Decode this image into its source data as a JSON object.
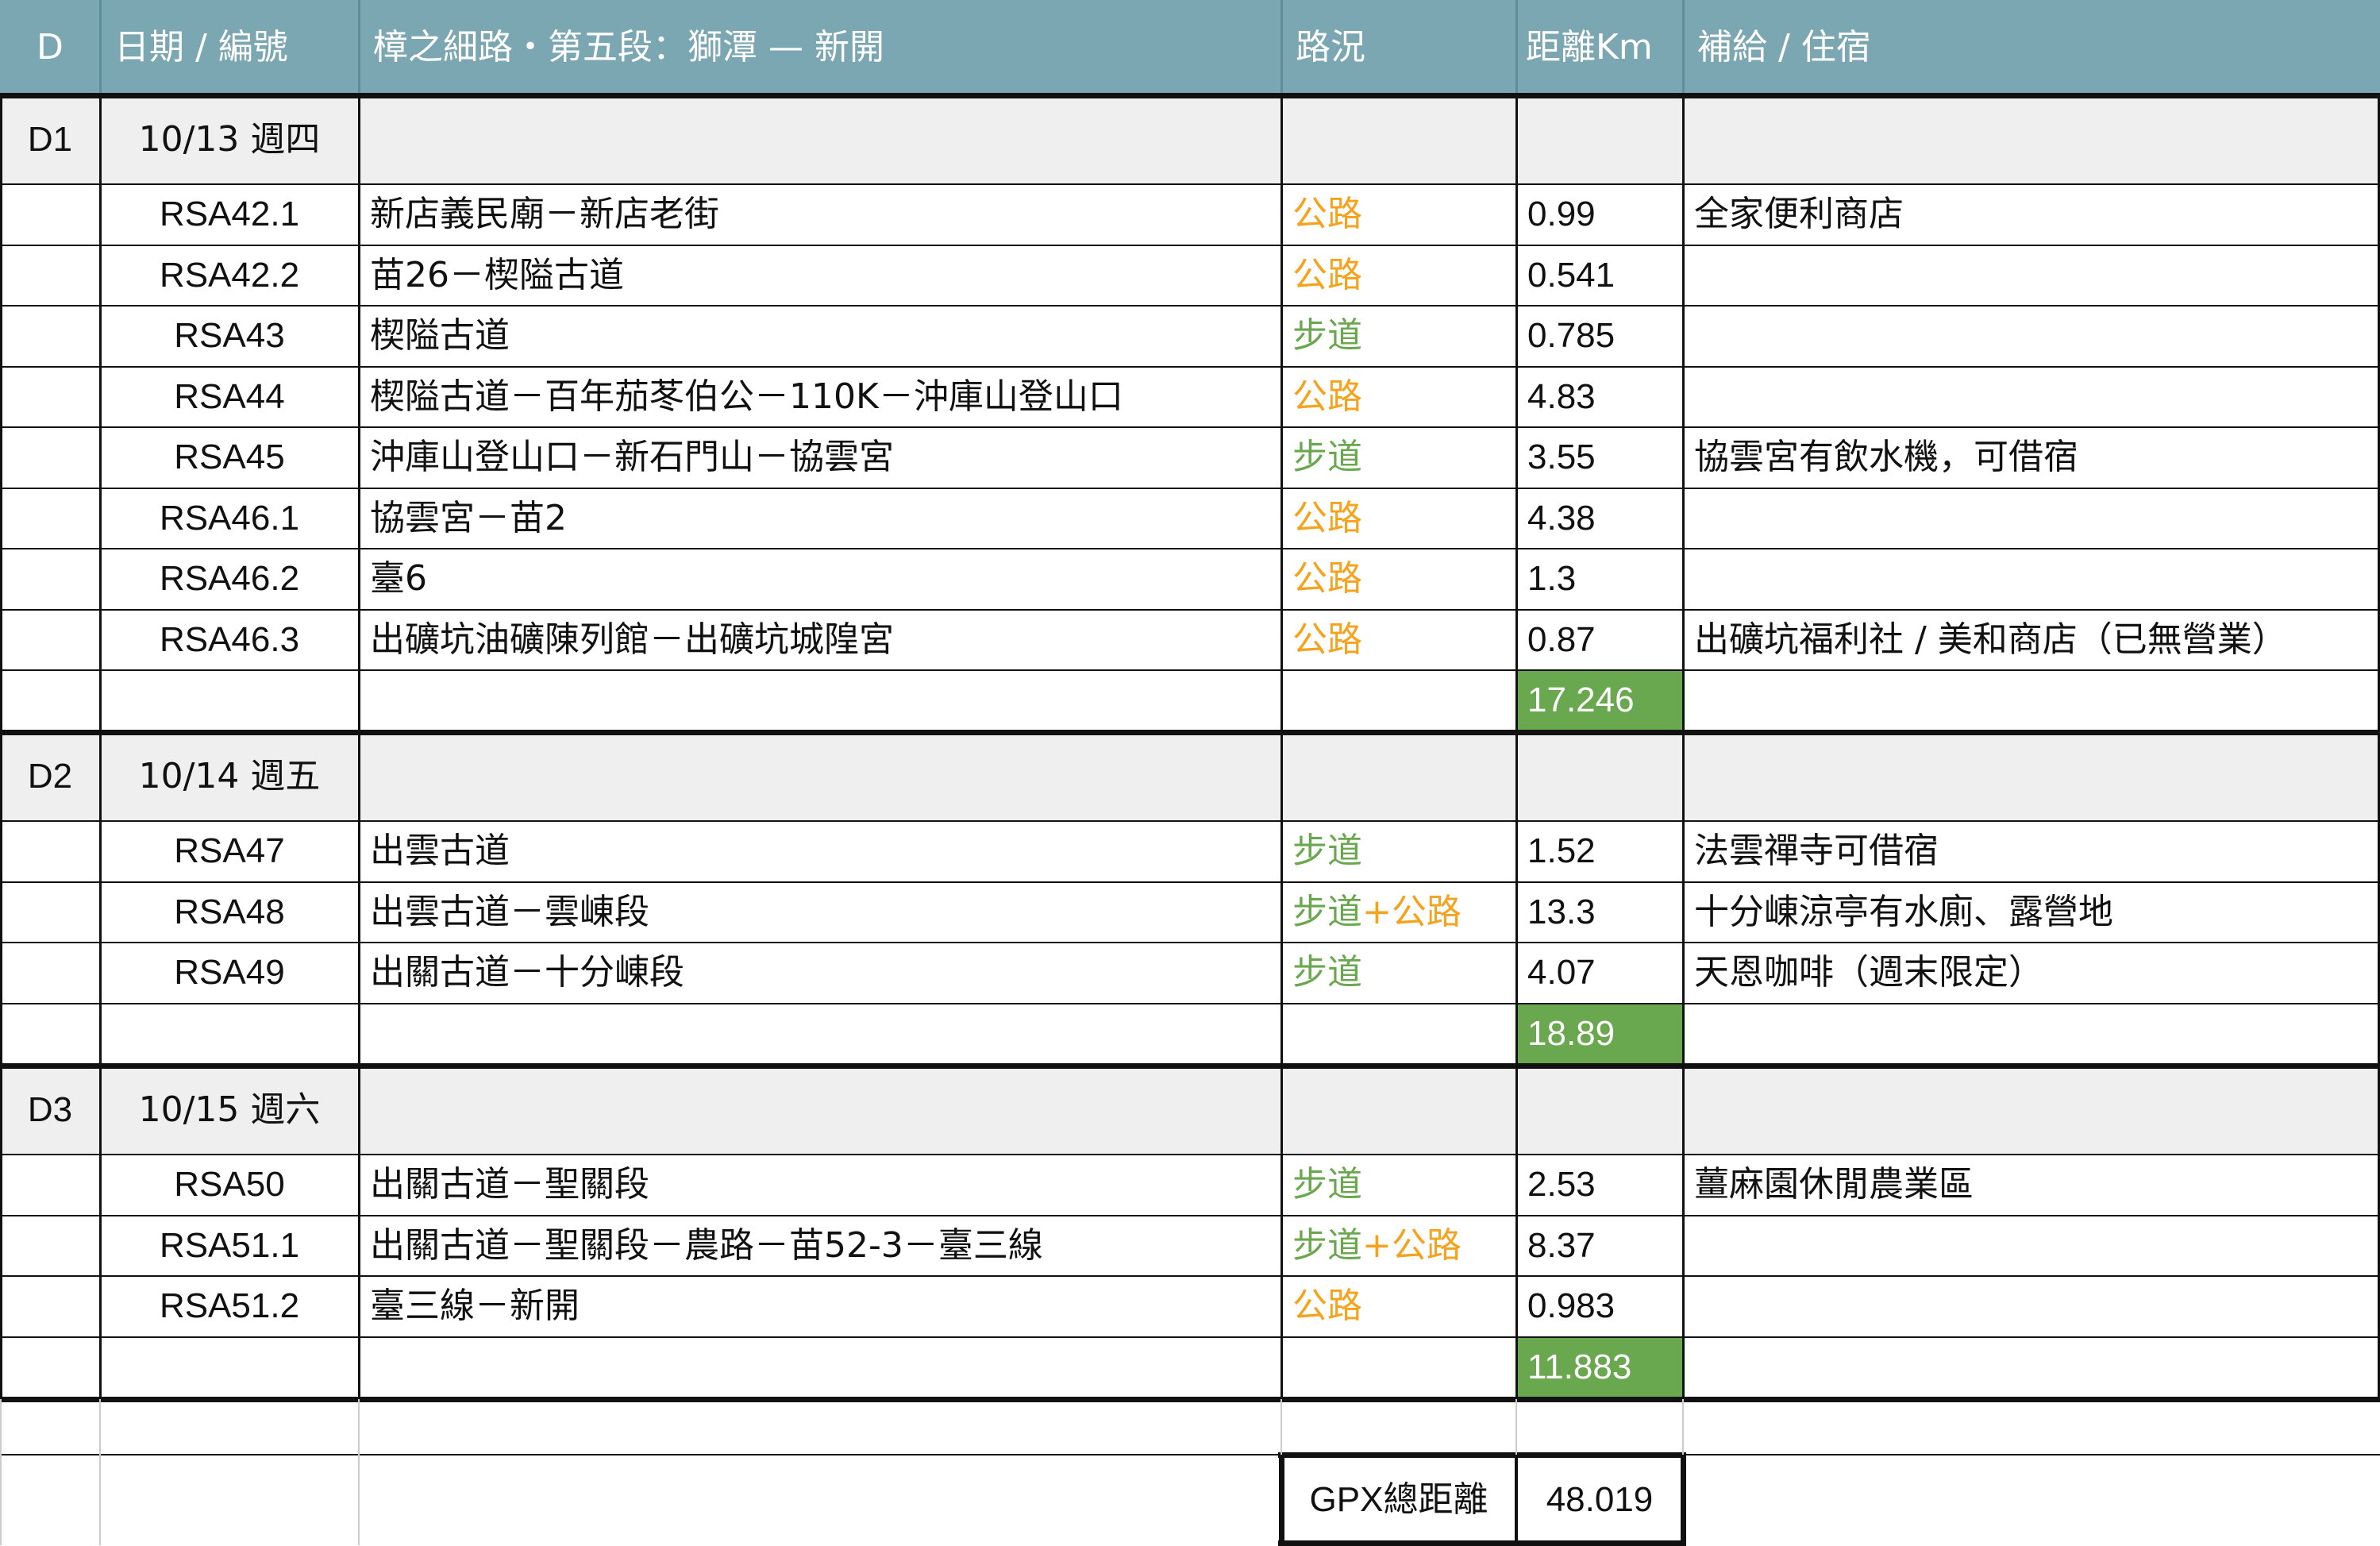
{
  "colors": {
    "header_bg": "#7ba7b2",
    "header_text": "#ffffff",
    "day_row_bg": "#efefef",
    "road": "#f5a21c",
    "trail": "#6aa84f",
    "subtotal_bg": "#6aa84f",
    "subtotal_text": "#ffffff",
    "grid": "#111111"
  },
  "header": {
    "day": "D",
    "date_code": "日期 / 編號",
    "route": "樟之細路・第五段：獅潭 — 新開",
    "condition": "路況",
    "distance": "距離Km",
    "supply": "補給 / 住宿"
  },
  "condition_labels": {
    "road": "公路",
    "trail": "步道",
    "plus": "+"
  },
  "days": [
    {
      "day": "D1",
      "date": "10/13 週四",
      "segments": [
        {
          "code": "RSA42.1",
          "route": "新店義民廟－新店老街",
          "cond": "road",
          "dist": "0.99",
          "supply": "全家便利商店"
        },
        {
          "code": "RSA42.2",
          "route": "苗26－楔隘古道",
          "cond": "road",
          "dist": "0.541",
          "supply": ""
        },
        {
          "code": "RSA43",
          "route": "楔隘古道",
          "cond": "trail",
          "dist": "0.785",
          "supply": ""
        },
        {
          "code": "RSA44",
          "route": "楔隘古道－百年茄苳伯公－110K－沖庫山登山口",
          "cond": "road",
          "dist": "4.83",
          "supply": ""
        },
        {
          "code": "RSA45",
          "route": "沖庫山登山口－新石門山－協雲宮",
          "cond": "trail",
          "dist": "3.55",
          "supply": "協雲宮有飲水機，可借宿"
        },
        {
          "code": "RSA46.1",
          "route": "協雲宮－苗2",
          "cond": "road",
          "dist": "4.38",
          "supply": ""
        },
        {
          "code": "RSA46.2",
          "route": "臺6",
          "cond": "road",
          "dist": "1.3",
          "supply": ""
        },
        {
          "code": "RSA46.3",
          "route": "出礦坑油礦陳列館－出礦坑城隍宮",
          "cond": "road",
          "dist": "0.87",
          "supply": "出礦坑福利社 / 美和商店（已無營業）"
        }
      ],
      "total": "17.246"
    },
    {
      "day": "D2",
      "date": "10/14 週五",
      "segments": [
        {
          "code": "RSA47",
          "route": "出雲古道",
          "cond": "trail",
          "dist": "1.52",
          "supply": "法雲禪寺可借宿"
        },
        {
          "code": "RSA48",
          "route": "出雲古道－雲崠段",
          "cond": "trail+road",
          "dist": "13.3",
          "supply": "十分崠涼亭有水廁、露營地"
        },
        {
          "code": "RSA49",
          "route": "出關古道－十分崠段",
          "cond": "trail",
          "dist": "4.07",
          "supply": "天恩咖啡（週末限定）"
        }
      ],
      "total": "18.89"
    },
    {
      "day": "D3",
      "date": "10/15 週六",
      "segments": [
        {
          "code": "RSA50",
          "route": "出關古道－聖關段",
          "cond": "trail",
          "dist": "2.53",
          "supply": "薑麻園休閒農業區"
        },
        {
          "code": "RSA51.1",
          "route": "出關古道－聖關段－農路－苗52-3－臺三線",
          "cond": "trail+road",
          "dist": "8.37",
          "supply": ""
        },
        {
          "code": "RSA51.2",
          "route": "臺三線－新開",
          "cond": "road",
          "dist": "0.983",
          "supply": ""
        }
      ],
      "total": "11.883"
    }
  ],
  "grand_total": {
    "label": "GPX總距離",
    "value": "48.019"
  }
}
